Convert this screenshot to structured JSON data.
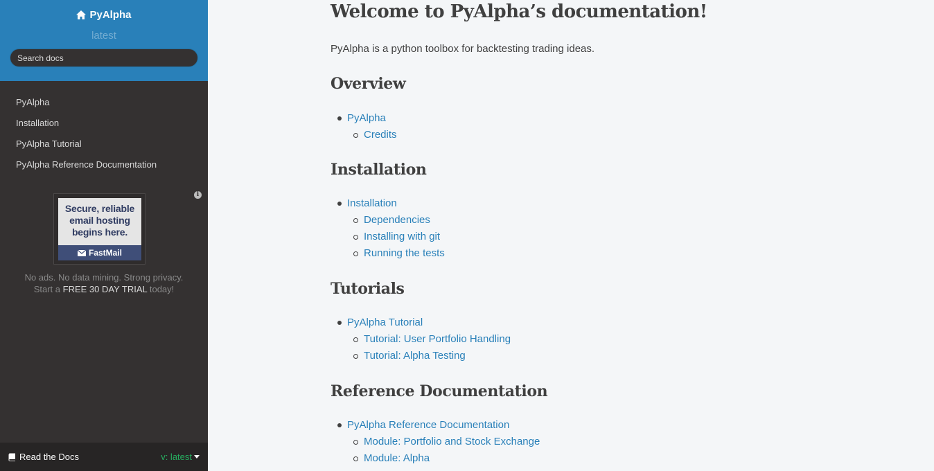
{
  "sidebar": {
    "project_name": "PyAlpha",
    "version": "latest",
    "search_placeholder": "Search docs",
    "nav": [
      {
        "label": "PyAlpha"
      },
      {
        "label": "Installation"
      },
      {
        "label": "PyAlpha Tutorial"
      },
      {
        "label": "PyAlpha Reference Documentation"
      }
    ],
    "ad": {
      "line1": "Secure, reliable",
      "line2": "email hosting",
      "line3": "begins here.",
      "brand": "FastMail",
      "caption_line1": "No ads. No data mining. Strong privacy.",
      "caption_start": "Start a ",
      "caption_highlight": "FREE 30 DAY TRIAL",
      "caption_end": " today!"
    },
    "footer": {
      "rtd_label": "Read the Docs",
      "version_label": "v: latest"
    }
  },
  "main": {
    "title": "Welcome to PyAlpha’s documentation!",
    "intro": "PyAlpha is a python toolbox for backtesting trading ideas.",
    "sections": [
      {
        "heading": "Overview",
        "items": [
          {
            "label": "PyAlpha",
            "level": 1
          },
          {
            "label": "Credits",
            "level": 2
          }
        ]
      },
      {
        "heading": "Installation",
        "items": [
          {
            "label": "Installation",
            "level": 1
          },
          {
            "label": "Dependencies",
            "level": 2
          },
          {
            "label": "Installing with git",
            "level": 2
          },
          {
            "label": "Running the tests",
            "level": 2
          }
        ]
      },
      {
        "heading": "Tutorials",
        "items": [
          {
            "label": "PyAlpha Tutorial",
            "level": 1
          },
          {
            "label": "Tutorial: User Portfolio Handling",
            "level": 2
          },
          {
            "label": "Tutorial: Alpha Testing",
            "level": 2
          }
        ]
      },
      {
        "heading": "Reference Documentation",
        "items": [
          {
            "label": "PyAlpha Reference Documentation",
            "level": 1
          },
          {
            "label": "Module: Portfolio and Stock Exchange",
            "level": 2
          },
          {
            "label": "Module: Alpha",
            "level": 2
          }
        ]
      }
    ]
  }
}
